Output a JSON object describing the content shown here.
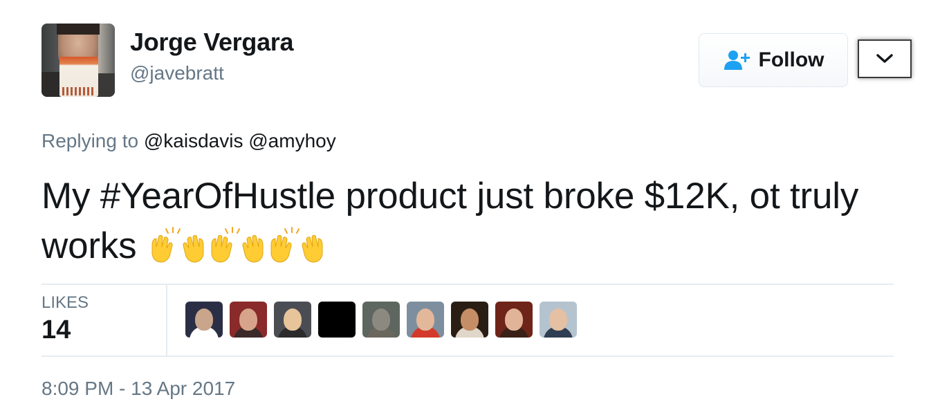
{
  "author": {
    "name": "Jorge Vergara",
    "handle": "@javebratt"
  },
  "actions": {
    "follow_label": "Follow",
    "follow_icon": "user-add-icon",
    "more_icon": "chevron-down-icon"
  },
  "reply": {
    "prefix": "Replying to",
    "mentions": [
      "@kaisdavis",
      "@amyhoy"
    ]
  },
  "tweet": {
    "text_before": "My ",
    "hashtag": "#YearOfHustle",
    "text_after": " product just broke $12K, ot truly works",
    "emojis": [
      "raising-hands-icon",
      "raising-hands-icon",
      "raising-hands-icon"
    ]
  },
  "stats": {
    "likes_label": "LIKES",
    "likes_count": "14",
    "likers": [
      {
        "name": "liker-avatar-1",
        "bg": "#2b2f45",
        "head": "#c9a58c",
        "body": "#ffffff"
      },
      {
        "name": "liker-avatar-2",
        "bg": "#8a2a2a",
        "head": "#d7a48b",
        "body": "#3a2a2a"
      },
      {
        "name": "liker-avatar-3",
        "bg": "#4b4d55",
        "head": "#e7c49a",
        "body": "#2b2b2b"
      },
      {
        "name": "liker-avatar-4",
        "bg": "#000000",
        "head": "#000000",
        "body": "#000000"
      },
      {
        "name": "liker-avatar-5",
        "bg": "#5e6660",
        "head": "#8c8a80",
        "body": "#6a675c"
      },
      {
        "name": "liker-avatar-6",
        "bg": "#7d8f9e",
        "head": "#e2b79a",
        "body": "#d33a2c"
      },
      {
        "name": "liker-avatar-7",
        "bg": "#2a1e14",
        "head": "#c68e67",
        "body": "#e0d6c9"
      },
      {
        "name": "liker-avatar-8",
        "bg": "#6e2418",
        "head": "#e1b49a",
        "body": "#3b2018"
      },
      {
        "name": "liker-avatar-9",
        "bg": "#b5c3cf",
        "head": "#e5c0a2",
        "body": "#2f3e52"
      }
    ]
  },
  "meta": {
    "timestamp": "8:09 PM - 13 Apr 2017"
  },
  "colors": {
    "text": "#14171a",
    "secondary": "#657786",
    "follow_icon": "#1da1f2",
    "divider": "#e6ecf0",
    "emoji_yellow": "#ffcc33"
  }
}
